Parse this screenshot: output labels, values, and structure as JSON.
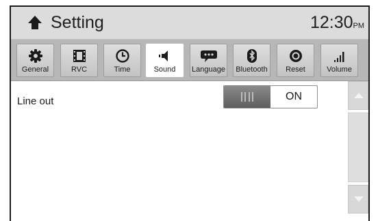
{
  "header": {
    "title": "Setting",
    "time": "12:30",
    "ampm": "PM"
  },
  "tabs": [
    {
      "label": "General",
      "icon": "gear-icon"
    },
    {
      "label": "RVC",
      "icon": "film-icon"
    },
    {
      "label": "Time",
      "icon": "clock-icon"
    },
    {
      "label": "Sound",
      "icon": "speaker-icon",
      "active": true
    },
    {
      "label": "Language",
      "icon": "speech-bubble-icon"
    },
    {
      "label": "Bluetooth",
      "icon": "bluetooth-icon"
    },
    {
      "label": "Reset",
      "icon": "reset-icon"
    },
    {
      "label": "Volume",
      "icon": "volume-bars-icon"
    }
  ],
  "content": {
    "line_out": {
      "label": "Line out",
      "state": "ON"
    }
  },
  "colors": {
    "header_bg": "#dcdcdc",
    "tabbar_bg": "#b7b7b7",
    "toggle_knob": "#6e6e6e"
  }
}
